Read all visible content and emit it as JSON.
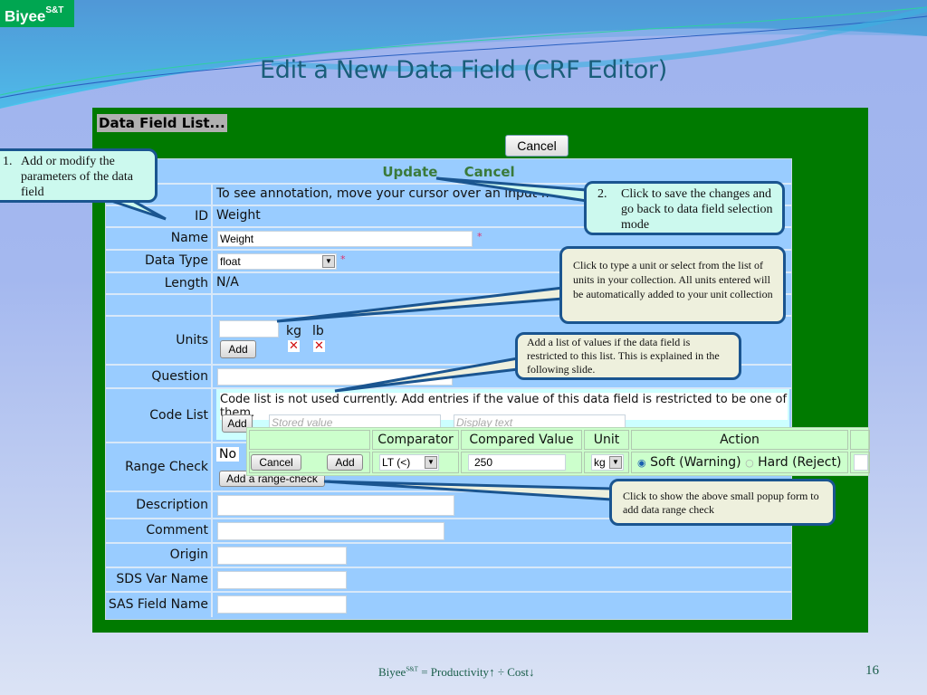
{
  "brand": {
    "name": "Biyee",
    "superscript": "S&T"
  },
  "slide": {
    "title": "Edit a New Data Field (CRF Editor)",
    "page_number": "16"
  },
  "footer": {
    "prefix": "Biyee",
    "sup": "S&T",
    "text": "= Productivity",
    "up_arrow": "↑",
    "divide": "÷",
    "cost": "Cost",
    "down_arrow": "↓"
  },
  "app": {
    "data_field_list_link": "Data Field List...",
    "top_cancel_label": "Cancel",
    "header": {
      "update_label": "Update",
      "cancel_label": "Cancel"
    },
    "hint_text": "To see annotation, move your cursor over an input fi",
    "fields": {
      "id": {
        "label": "ID",
        "value": "Weight"
      },
      "name": {
        "label": "Name",
        "value": "Weight",
        "required_mark": "*"
      },
      "data_type": {
        "label": "Data Type",
        "value": "float",
        "required_mark": "*"
      },
      "length": {
        "label": "Length",
        "value": "N/A"
      },
      "units": {
        "label": "Units",
        "input_value": "",
        "add_label": "Add",
        "items": [
          {
            "name": "kg",
            "remove_icon": "x-icon"
          },
          {
            "name": "lb",
            "remove_icon": "x-icon"
          }
        ]
      },
      "question": {
        "label": "Question",
        "value": ""
      },
      "code_list": {
        "label": "Code List",
        "note": "Code list is not used currently. Add entries if the value of this data field is restricted to be one of them.",
        "add_label": "Add",
        "stored_placeholder": "Stored value",
        "display_placeholder": "Display text"
      },
      "range_check": {
        "label": "Range Check",
        "value": "No",
        "add_label": "Add a range-check"
      },
      "description": {
        "label": "Description",
        "value": ""
      },
      "comment": {
        "label": "Comment",
        "value": ""
      },
      "origin": {
        "label": "Origin",
        "value": ""
      },
      "sds_var_name": {
        "label": "SDS Var Name",
        "value": ""
      },
      "sas_field_name": {
        "label": "SAS Field Name",
        "value": ""
      }
    },
    "range_popup": {
      "headers": {
        "comparator": "Comparator",
        "compared_value": "Compared Value",
        "unit": "Unit",
        "action": "Action"
      },
      "cancel_label": "Cancel",
      "add_label": "Add",
      "comparator_value": "LT (<)",
      "compared_value": "250",
      "unit_value": "kg",
      "action_options": [
        {
          "label": "Soft (Warning)",
          "selected": true
        },
        {
          "label": "Hard (Reject)",
          "selected": false
        }
      ]
    }
  },
  "callouts": {
    "c1": {
      "number": "1.",
      "text": "Add or modify the parameters of the data field"
    },
    "c2": {
      "number": "2.",
      "text": "Click to save the changes and go back to data field selection mode"
    },
    "c3": {
      "text": "Click to type a unit or select from the list of units in your collection. All units entered will be automatically added to your unit collection"
    },
    "c4": {
      "text": "Add a  list of values if the data field is restricted to this list.  This is explained in the following slide."
    },
    "c5": {
      "text": "Click to show the above  small popup form to add data range check"
    }
  },
  "colors": {
    "app_bg": "#007a00",
    "form_bg": "#99ccff",
    "popup_bg": "#ccffcc",
    "brand_green": "#00a651",
    "title_color": "#1a5e7a",
    "callout_border": "#1a5590"
  }
}
